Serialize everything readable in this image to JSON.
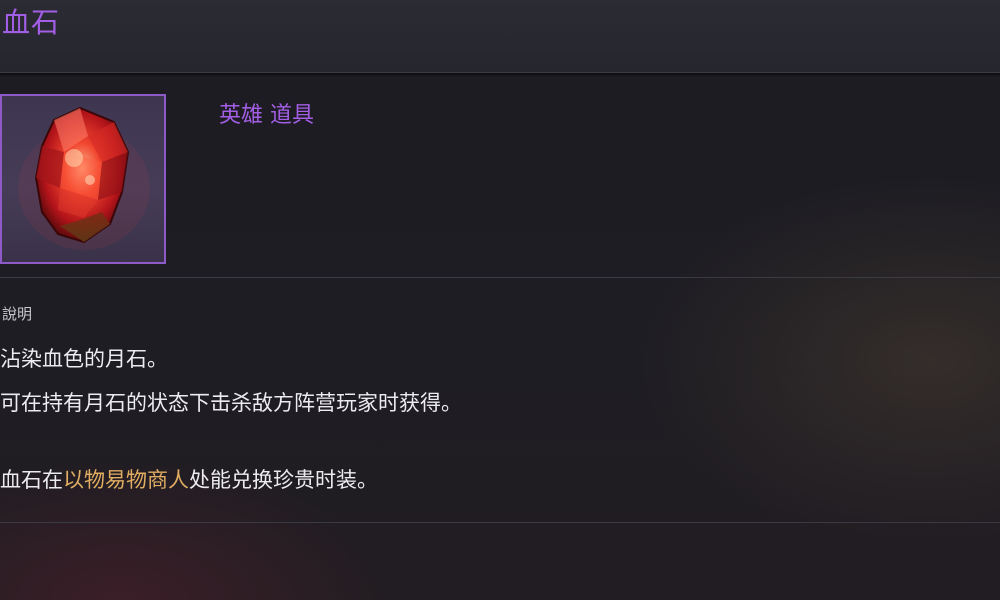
{
  "item": {
    "name": "血石",
    "category": "英雄 道具",
    "icon": "blood-stone-icon"
  },
  "description": {
    "label": "說明",
    "lines": [
      "沾染血色的月石。",
      "可在持有月石的状态下击杀敌方阵营玩家时获得。"
    ],
    "exchange": {
      "prefix": "血石在",
      "merchant": "以物易物商人",
      "suffix": "处能兑换珍贵时装。"
    }
  },
  "colors": {
    "title": "#a35ee6",
    "highlight": "#e0ad62",
    "frame_border": "#8e5ac8"
  }
}
